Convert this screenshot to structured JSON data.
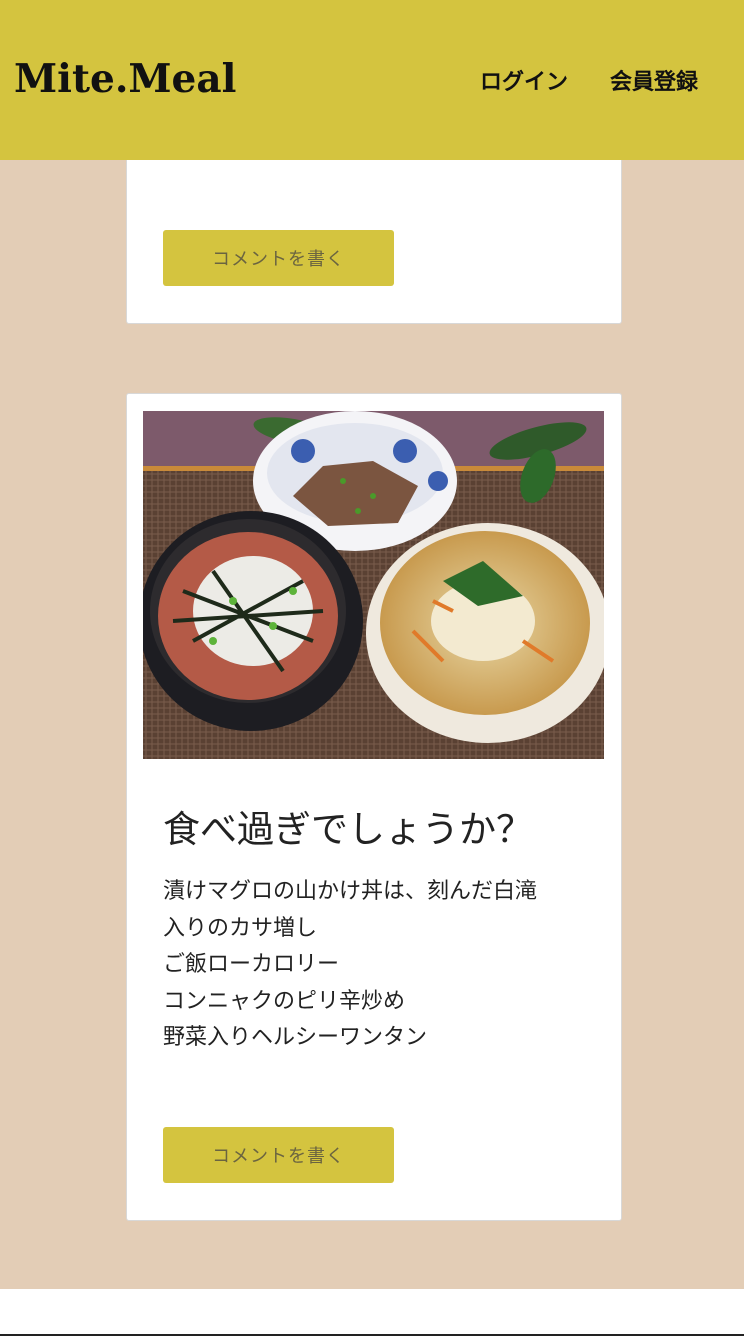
{
  "header": {
    "logo": "Mite.Meal",
    "nav": {
      "login": "ログイン",
      "register": "会員登録"
    }
  },
  "posts": [
    {
      "comment_button": "コメントを書く"
    },
    {
      "title": "食べ過ぎでしょうか？",
      "body_lines": [
        "漬けマグロの山かけ丼は、刻んだ白滝",
        "入りのカサ増し",
        "ご飯ローカロリー",
        "コンニャクのピリ辛炒め",
        "野菜入りヘルシーワンタン"
      ],
      "comment_button": "コメントを書く"
    }
  ],
  "colors": {
    "accent": "#d4c43f",
    "background": "#e3cdb6"
  }
}
